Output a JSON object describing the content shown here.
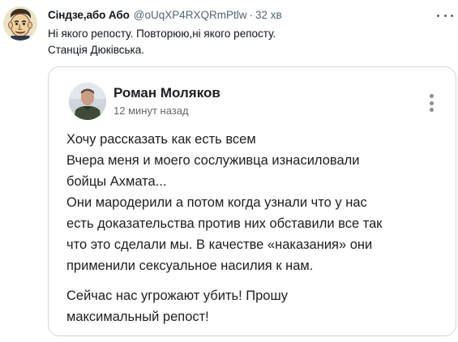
{
  "tweet": {
    "display_name": "Сіндзе,або Або",
    "handle": "@oUqXP4RXQRmPtlw",
    "separator": "·",
    "time": "32 хв",
    "text_lines": [
      "Ні якого репосту. Повторюю,ні якого репосту.",
      "Станція Дюківська."
    ]
  },
  "embedded_post": {
    "author": "Роман Моляков",
    "time": "12 минут назад",
    "lines": [
      "Хочу рассказать как есть всем",
      " Вчера меня и моего сослуживца изнасиловали",
      "бойцы Ахмата...",
      " Они мародерили а потом когда узнали что у нас",
      "есть доказательства против них обставили все так",
      "что это сделали мы. В качестве «наказания» они",
      "применили сексуальное насилия к нам.",
      " Сейчас нас угрожают убить! Прошу",
      "максимальный репост!"
    ]
  },
  "icons": {
    "tweet_more": "more-horizontal-icon",
    "post_more": "more-vertical-icon"
  },
  "colors": {
    "primary_text": "#0f1419",
    "secondary_text": "#536471",
    "card_border": "#cfd9de",
    "fb_text": "#1c1e21",
    "fb_secondary": "#65676b"
  }
}
